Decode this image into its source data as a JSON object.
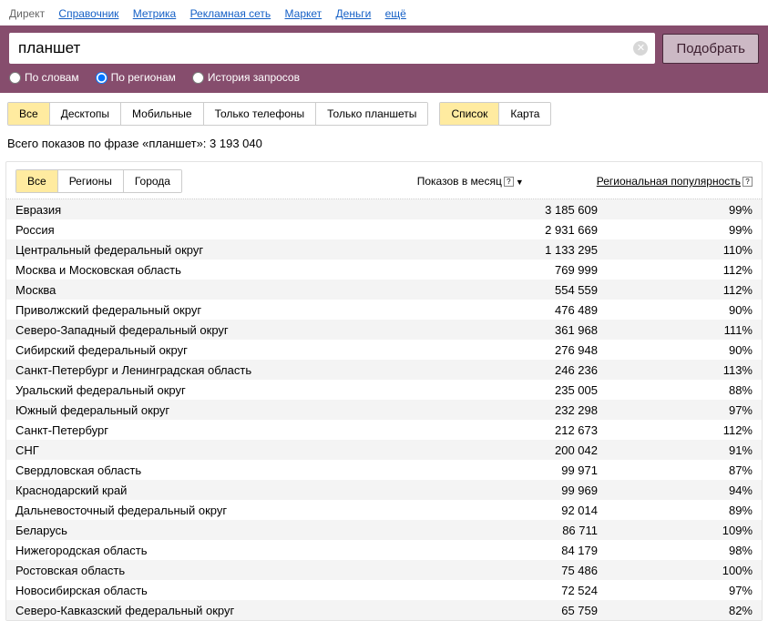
{
  "topnav": {
    "links": [
      "Директ",
      "Справочник",
      "Метрика",
      "Рекламная сеть",
      "Маркет",
      "Деньги",
      "ещё"
    ]
  },
  "search": {
    "value": "планшет",
    "submit": "Подобрать"
  },
  "radios": {
    "by_words": "По словам",
    "by_regions": "По регионам",
    "history": "История запросов"
  },
  "device_tabs": [
    "Все",
    "Десктопы",
    "Мобильные",
    "Только телефоны",
    "Только планшеты"
  ],
  "view_tabs": [
    "Список",
    "Карта"
  ],
  "summary": "Всего показов по фразе «планшет»: 3 193 040",
  "subtabs": [
    "Все",
    "Регионы",
    "Города"
  ],
  "col_shows": "Показов в месяц",
  "col_pop": "Региональная популярность",
  "rows": [
    {
      "name": "Евразия",
      "num": "3 185 609",
      "pct": "99%"
    },
    {
      "name": "Россия",
      "num": "2 931 669",
      "pct": "99%"
    },
    {
      "name": "Центральный федеральный округ",
      "num": "1 133 295",
      "pct": "110%"
    },
    {
      "name": "Москва и Московская область",
      "num": "769 999",
      "pct": "112%"
    },
    {
      "name": "Москва",
      "num": "554 559",
      "pct": "112%"
    },
    {
      "name": "Приволжский федеральный округ",
      "num": "476 489",
      "pct": "90%"
    },
    {
      "name": "Северо-Западный федеральный округ",
      "num": "361 968",
      "pct": "111%"
    },
    {
      "name": "Сибирский федеральный округ",
      "num": "276 948",
      "pct": "90%"
    },
    {
      "name": "Санкт-Петербург и Ленинградская область",
      "num": "246 236",
      "pct": "113%"
    },
    {
      "name": "Уральский федеральный округ",
      "num": "235 005",
      "pct": "88%"
    },
    {
      "name": "Южный федеральный округ",
      "num": "232 298",
      "pct": "97%"
    },
    {
      "name": "Санкт-Петербург",
      "num": "212 673",
      "pct": "112%"
    },
    {
      "name": "СНГ",
      "num": "200 042",
      "pct": "91%"
    },
    {
      "name": "Свердловская область",
      "num": "99 971",
      "pct": "87%"
    },
    {
      "name": "Краснодарский край",
      "num": "99 969",
      "pct": "94%"
    },
    {
      "name": "Дальневосточный федеральный округ",
      "num": "92 014",
      "pct": "89%"
    },
    {
      "name": "Беларусь",
      "num": "86 711",
      "pct": "109%"
    },
    {
      "name": "Нижегородская область",
      "num": "84 179",
      "pct": "98%"
    },
    {
      "name": "Ростовская область",
      "num": "75 486",
      "pct": "100%"
    },
    {
      "name": "Новосибирская область",
      "num": "72 524",
      "pct": "97%"
    },
    {
      "name": "Северо-Кавказский федеральный округ",
      "num": "65 759",
      "pct": "82%"
    }
  ]
}
